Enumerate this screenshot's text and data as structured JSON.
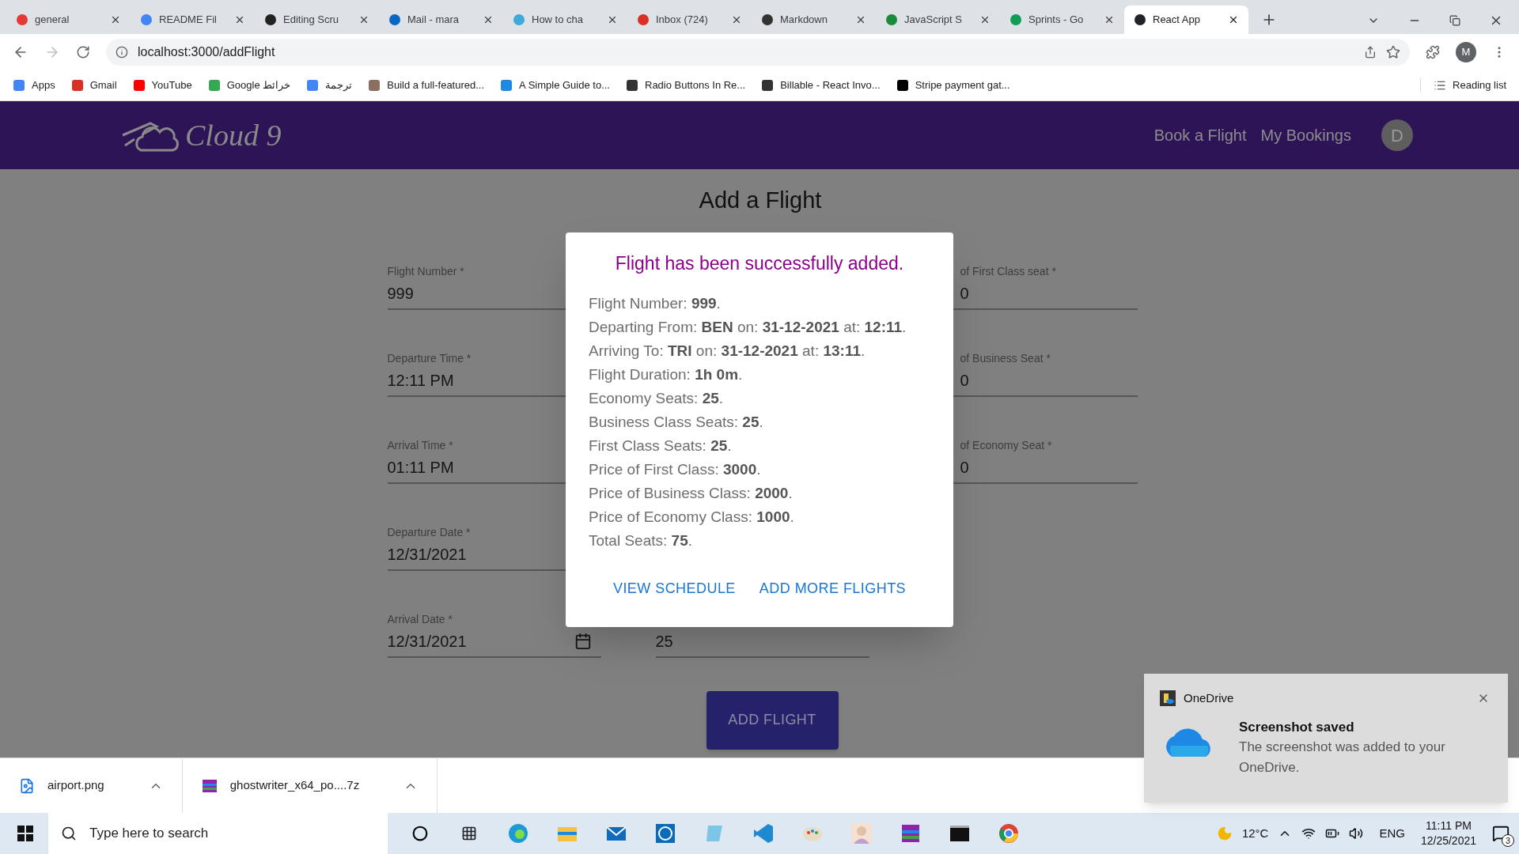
{
  "browser": {
    "tabs": [
      {
        "title": "general",
        "selected": false,
        "color": "#e53935"
      },
      {
        "title": "README Fil",
        "selected": false,
        "color": "#4285f4"
      },
      {
        "title": "Editing Scru",
        "selected": false,
        "color": "#222222"
      },
      {
        "title": "Mail - mara",
        "selected": false,
        "color": "#0a66c2"
      },
      {
        "title": "How to cha",
        "selected": false,
        "color": "#3fa9d8"
      },
      {
        "title": "Inbox (724)",
        "selected": false,
        "color": "#d93025"
      },
      {
        "title": "Markdown",
        "selected": false,
        "color": "#333333"
      },
      {
        "title": "JavaScript S",
        "selected": false,
        "color": "#1a8a3c"
      },
      {
        "title": "Sprints - Go",
        "selected": false,
        "color": "#0f9d58"
      },
      {
        "title": "React App",
        "selected": true,
        "color": "#20232a"
      }
    ],
    "address": "localhost:3000/addFlight",
    "profile_initial": "M",
    "bookmarks": [
      {
        "title": "Apps",
        "color": "#4285f4"
      },
      {
        "title": "Gmail",
        "color": "#d93025"
      },
      {
        "title": "YouTube",
        "color": "#ff0000"
      },
      {
        "title": "Google خرائط",
        "color": "#34a853"
      },
      {
        "title": "ترجمة",
        "color": "#4285f4"
      },
      {
        "title": "Build a full-featured...",
        "color": "#8d6e63"
      },
      {
        "title": "A Simple Guide to...",
        "color": "#1e88e5"
      },
      {
        "title": "Radio Buttons In Re...",
        "color": "#333333"
      },
      {
        "title": "Billable - React Invo...",
        "color": "#333333"
      },
      {
        "title": "Stripe payment gat...",
        "color": "#000000"
      }
    ],
    "reading_list": "Reading list"
  },
  "navbar": {
    "logo": "Cloud 9",
    "links": [
      "Book a Flight",
      "My Bookings"
    ],
    "avatar": "D"
  },
  "page": {
    "title": "Add a Flight",
    "left_fields": [
      {
        "label": "Flight Number *",
        "value": "999",
        "kind": "text"
      },
      {
        "label": "Departure Time *",
        "value": "12:11 PM",
        "kind": "text"
      },
      {
        "label": "Arrival Time *",
        "value": "01:11 PM",
        "kind": "text"
      },
      {
        "label": "Departure Date *",
        "value": "12/31/2021",
        "kind": "text"
      },
      {
        "label": "Arrival Date *",
        "value": "12/31/2021",
        "kind": "date"
      }
    ],
    "middle_value": "25",
    "right_fields": [
      {
        "label": "of First Class seat *",
        "value": "0"
      },
      {
        "label": "of Business Seat *",
        "value": "0"
      },
      {
        "label": "of Economy Seat *",
        "value": "0"
      }
    ],
    "submit": "ADD FLIGHT"
  },
  "dialog": {
    "title": "Flight has been successfully added.",
    "lines": [
      "Flight Number: **999**.",
      "Departing From: **BEN** on: **31-12-2021** at: **12:11**.",
      "Arriving To: **TRI** on: **31-12-2021** at: **13:11**.",
      "Flight Duration: **1h 0m**.",
      "Economy Seats: **25**.",
      "Business Class Seats: **25**.",
      "First Class Seats: **25**.",
      "Price of First Class: **3000**.",
      "Price of Business Class: **2000**.",
      "Price of Economy Class: **1000**.",
      "Total Seats: **75**."
    ],
    "actions": [
      "VIEW SCHEDULE",
      "ADD MORE FLIGHTS"
    ]
  },
  "downloads": [
    {
      "name": "airport.png",
      "kind": "image"
    },
    {
      "name": "ghostwriter_x64_po....7z",
      "kind": "archive"
    }
  ],
  "toast": {
    "app": "OneDrive",
    "title": "Screenshot saved",
    "body": "The screenshot was added to your OneDrive."
  },
  "taskbar": {
    "search_placeholder": "Type here to search",
    "weather": "12°C",
    "language": "ENG",
    "time": "11:11 PM",
    "date": "12/25/2021",
    "notifications": "3"
  }
}
